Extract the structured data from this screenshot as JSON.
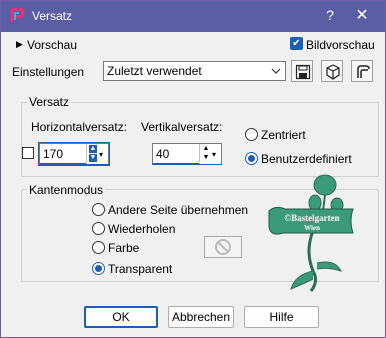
{
  "window": {
    "title": "Versatz"
  },
  "preview": {
    "label": "Vorschau",
    "image_preview_label": "Bildvorschau",
    "image_preview_checked": true
  },
  "settings": {
    "label": "Einstellungen",
    "preset_value": "Zuletzt verwendet"
  },
  "offset_group": {
    "title": "Versatz",
    "horizontal_label": "Horizontalversatz:",
    "horizontal_value": "170",
    "vertical_label": "Vertikalversatz:",
    "vertical_value": "40",
    "options": [
      "Zentriert",
      "Benutzerdefiniert"
    ],
    "selected": "Benutzerdefiniert"
  },
  "edge_group": {
    "title": "Kantenmodus",
    "options": [
      "Andere Seite übernehmen",
      "Wiederholen",
      "Farbe",
      "Transparent"
    ],
    "selected": "Transparent"
  },
  "watermark": {
    "text_line1": "©Bastelgarten",
    "text_line2": "Wien"
  },
  "buttons": {
    "ok": "OK",
    "cancel": "Abbrechen",
    "help": "Hilfe"
  },
  "colors": {
    "titlebar": "#5a5fa5",
    "accent": "#1a5fb4",
    "watermark": "#3a9a7a"
  },
  "icons": [
    "app-icon",
    "help-icon",
    "close-icon",
    "save-icon",
    "cube-icon",
    "reset-icon",
    "no-color-icon"
  ]
}
